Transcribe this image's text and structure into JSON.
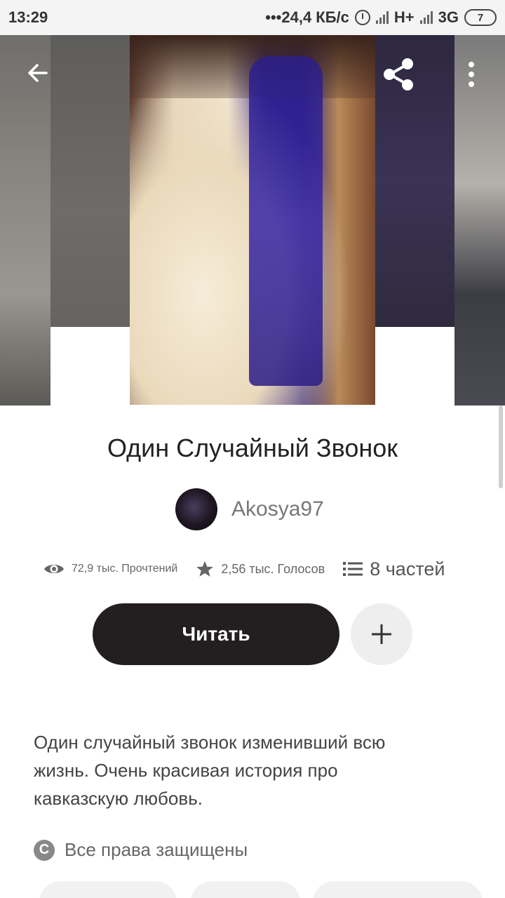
{
  "status_bar": {
    "time": "13:29",
    "network_speed": "•••24,4 КБ/с",
    "network_1": "H+",
    "network_2": "3G",
    "battery": "7"
  },
  "icons": {
    "back": "arrow-left-icon",
    "share": "share-icon",
    "more": "more-vertical-icon",
    "reads": "eye-icon",
    "votes": "star-icon",
    "parts": "list-icon",
    "add": "plus-icon",
    "copyright": "copyright-icon"
  },
  "story": {
    "title": "Один Случайный Звонок",
    "author": "Akosya97",
    "reads": "72,9 тыс. Прочтений",
    "votes": "2,56 тыс. Голосов",
    "parts": "8 частей",
    "read_button": "Читать",
    "description": "Один случайный звонок изменивший всю жизнь. Очень красивая история про кавказскую любовь.",
    "rights": "Все права защищены"
  },
  "colors": {
    "primary_button": "#231f20",
    "secondary_button": "#eeeeee"
  }
}
